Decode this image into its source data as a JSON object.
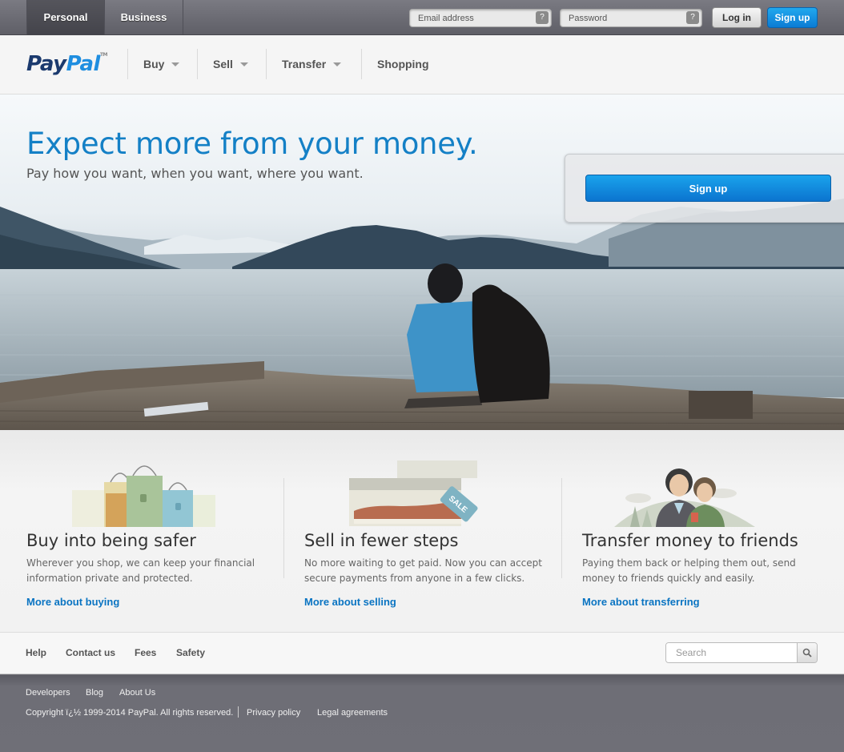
{
  "topbar": {
    "tabs": [
      {
        "label": "Personal",
        "active": true
      },
      {
        "label": "Business",
        "active": false
      }
    ],
    "email_placeholder": "Email address",
    "password_placeholder": "Password",
    "help_glyph": "?",
    "login_label": "Log in",
    "signup_label": "Sign up"
  },
  "header": {
    "logo_pay": "Pay",
    "logo_pal": "Pal",
    "logo_tm": "TM",
    "nav": [
      {
        "label": "Buy",
        "has_dropdown": true
      },
      {
        "label": "Sell",
        "has_dropdown": true
      },
      {
        "label": "Transfer",
        "has_dropdown": true
      },
      {
        "label": "Shopping",
        "has_dropdown": false
      }
    ]
  },
  "hero": {
    "title": "Expect more from your money.",
    "subtitle": "Pay how you want, when you want, where you want.",
    "signup_label": "Sign up"
  },
  "features": [
    {
      "icon": "shopping-bags-icon",
      "title": "Buy into being safer",
      "text": "Wherever you shop, we can keep your financial information private and protected.",
      "link": "More about buying"
    },
    {
      "icon": "shoe-sale-tag-icon",
      "title": "Sell in fewer steps",
      "text": "No more waiting to get paid. Now you can accept secure payments from anyone in a few clicks.",
      "link": "More about selling"
    },
    {
      "icon": "two-people-icon",
      "title": "Transfer money to friends",
      "text": "Paying them back or helping them out, send money to friends quickly and easily.",
      "link": "More about transferring"
    }
  ],
  "footer_links": [
    "Help",
    "Contact us",
    "Fees",
    "Safety"
  ],
  "search_placeholder": "Search",
  "bottom": {
    "links": [
      "Developers",
      "Blog",
      "About Us"
    ],
    "copyright": "Copyright ï¿½ 1999-2014 PayPal. All rights reserved.",
    "privacy": "Privacy policy",
    "legal": "Legal agreements"
  },
  "colors": {
    "brand_dark": "#1b3a6e",
    "brand_light": "#1f8ee0",
    "link": "#0a74c2",
    "primary_button": "#0b7bd4"
  }
}
